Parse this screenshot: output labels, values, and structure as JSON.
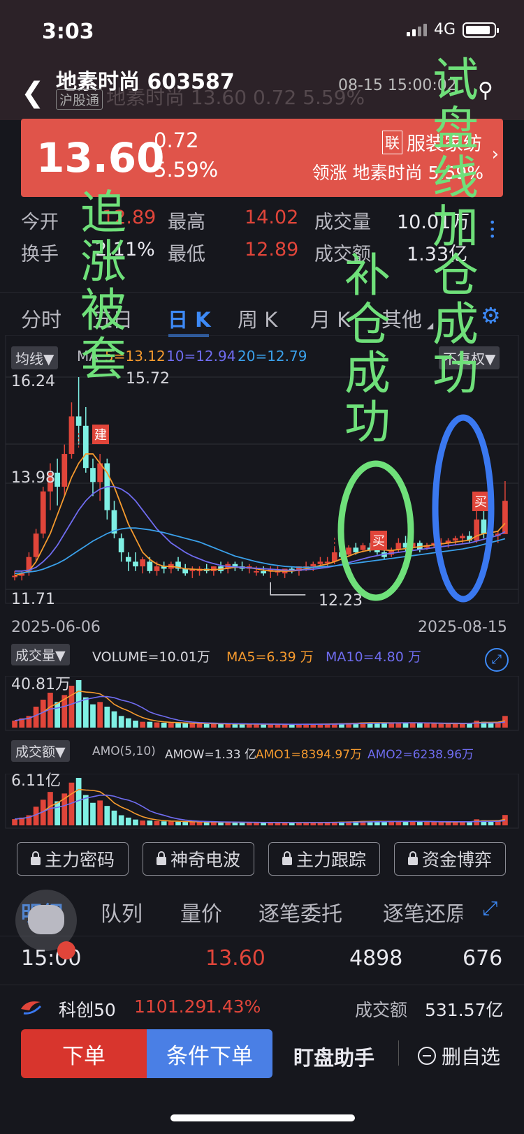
{
  "status": {
    "time": "3:03",
    "network": "4G"
  },
  "header": {
    "title": "地素时尚 603587",
    "badge": "沪股通",
    "ghost": "地素时尚  13.60  0.72  5.59%",
    "datetime": "08-15 15:00:02"
  },
  "price": {
    "last": "13.60",
    "change": "0.72",
    "pct": "5.59%",
    "sector_badge": "联",
    "sector": "服装家纺",
    "lead": "领涨 地素时尚 5.59%"
  },
  "stats": {
    "open_label": "今开",
    "open": "12.89",
    "high_label": "最高",
    "high": "14.02",
    "vol_label": "成交量",
    "vol": "10.01万",
    "turnover_label": "换手",
    "turnover": "2.11%",
    "low_label": "最低",
    "low": "12.89",
    "amt_label": "成交额",
    "amt": "1.33亿"
  },
  "tabs": [
    {
      "label": "分时"
    },
    {
      "label": "五日"
    },
    {
      "label": "日 K"
    },
    {
      "label": "周 K"
    },
    {
      "label": "月 K"
    },
    {
      "label": "其他"
    }
  ],
  "kchart": {
    "ma_pill": "均线▼",
    "ma_title": "MA",
    "ma5": "5=13.12",
    "ma10": "10=12.94",
    "ma20": "20=12.79",
    "adjust_pill": "不复权▼",
    "y_top": "16.24",
    "y_mid": "13.98",
    "y_bot": "11.71",
    "max_label": "15.72",
    "min_label": "12.23",
    "date_start": "2025-06-06",
    "date_end": "2025-08-15",
    "mark_build": "建",
    "mark_buy1": "买",
    "mark_buy2": "买"
  },
  "volume": {
    "pill": "成交量▼",
    "main": "VOLUME=10.01万",
    "ma5": "MA5=6.39 万",
    "ma10": "MA10=4.80 万",
    "max": "40.81万"
  },
  "amount": {
    "pill": "成交额▼",
    "params": "AMO(5,10)",
    "amow": "AMOW=1.33 亿",
    "amo1": "AMO1=8394.97万",
    "amo2": "AMO2=6238.96万",
    "max": "6.11亿"
  },
  "tool_buttons": [
    "主力密码",
    "神奇电波",
    "主力跟踪",
    "资金博弈"
  ],
  "detail_tabs": [
    "明细",
    "队列",
    "量价",
    "逐笔委托",
    "逐笔还原"
  ],
  "tick": {
    "time": "15:00",
    "price": "13.60",
    "volume": "4898",
    "count": "676"
  },
  "index_bar": {
    "name": "科创50",
    "value": "1101.29",
    "pct": "1.43%",
    "amt_label": "成交额",
    "amt": "531.57亿"
  },
  "actions": {
    "order": "下单",
    "conditional": "条件下单",
    "assistant": "盯盘助手",
    "remove_fav": "删自选"
  },
  "annotations": {
    "left": "追涨被套",
    "middle": "补仓成功",
    "right": "试盘线加仓成功"
  },
  "colors": {
    "up": "#e0453a",
    "down": "#7ff0e4",
    "ma5": "#f59a2e",
    "ma10": "#6f6cf0",
    "ma20": "#3aa0ea",
    "accent": "#3d8af7",
    "anno_green": "#6fe07a",
    "circle_green": "#6fe07a",
    "circle_blue": "#3a78f0"
  },
  "chart_data": [
    {
      "type": "candlestick",
      "title": "日K",
      "x_start": "2025-06-06",
      "x_end": "2025-08-15",
      "ylim": [
        11.71,
        16.24
      ],
      "candles": [
        [
          12.0,
          12.1,
          11.9,
          12.0
        ],
        [
          12.0,
          12.1,
          11.9,
          12.05
        ],
        [
          12.1,
          12.5,
          12.0,
          12.4
        ],
        [
          12.4,
          13.0,
          12.3,
          12.9
        ],
        [
          12.9,
          13.9,
          12.8,
          13.8
        ],
        [
          13.8,
          14.4,
          13.4,
          14.2
        ],
        [
          14.2,
          14.5,
          13.5,
          13.9
        ],
        [
          13.9,
          14.8,
          13.7,
          14.6
        ],
        [
          14.6,
          15.7,
          14.5,
          15.4
        ],
        [
          15.4,
          16.24,
          14.8,
          15.2
        ],
        [
          15.2,
          15.6,
          14.2,
          14.3
        ],
        [
          14.3,
          14.5,
          13.7,
          14.0
        ],
        [
          14.0,
          14.6,
          13.6,
          14.4
        ],
        [
          14.4,
          14.5,
          13.2,
          13.4
        ],
        [
          13.4,
          13.6,
          12.8,
          12.9
        ],
        [
          12.8,
          12.9,
          12.3,
          12.5
        ],
        [
          12.4,
          12.5,
          12.1,
          12.3
        ],
        [
          12.3,
          12.5,
          12.1,
          12.2
        ],
        [
          12.2,
          12.4,
          12.05,
          12.35
        ],
        [
          12.3,
          12.4,
          12.05,
          12.1
        ],
        [
          12.1,
          12.3,
          12.0,
          12.2
        ],
        [
          12.2,
          12.3,
          12.05,
          12.15
        ],
        [
          12.15,
          12.3,
          12.05,
          12.25
        ],
        [
          12.3,
          12.4,
          12.1,
          12.15
        ],
        [
          12.15,
          12.25,
          12.0,
          12.05
        ],
        [
          12.1,
          12.2,
          11.95,
          12.15
        ],
        [
          12.1,
          12.2,
          12.0,
          12.15
        ],
        [
          12.15,
          12.25,
          12.05,
          12.1
        ],
        [
          12.1,
          12.2,
          12.0,
          12.2
        ],
        [
          12.2,
          12.3,
          12.05,
          12.1
        ],
        [
          12.15,
          12.3,
          12.05,
          12.25
        ],
        [
          12.25,
          12.3,
          12.1,
          12.2
        ],
        [
          12.2,
          12.3,
          12.1,
          12.15
        ],
        [
          12.15,
          12.25,
          12.05,
          12.2
        ],
        [
          12.1,
          12.2,
          12.0,
          12.1
        ],
        [
          12.1,
          12.2,
          12.0,
          12.05
        ],
        [
          12.1,
          12.2,
          11.95,
          12.15
        ],
        [
          12.1,
          12.2,
          12.0,
          12.1
        ],
        [
          12.05,
          12.15,
          11.95,
          12.15
        ],
        [
          12.15,
          12.2,
          12.05,
          12.1
        ],
        [
          12.1,
          12.2,
          12.0,
          12.2
        ],
        [
          12.2,
          12.3,
          12.1,
          12.2
        ],
        [
          12.2,
          12.3,
          12.1,
          12.25
        ],
        [
          12.25,
          12.4,
          12.2,
          12.3
        ],
        [
          12.3,
          12.4,
          12.2,
          12.3
        ],
        [
          12.3,
          12.6,
          12.25,
          12.5
        ],
        [
          12.5,
          12.6,
          12.35,
          12.4
        ],
        [
          12.45,
          12.65,
          12.4,
          12.6
        ],
        [
          12.6,
          12.7,
          12.45,
          12.5
        ],
        [
          12.55,
          12.7,
          12.5,
          12.65
        ],
        [
          12.6,
          12.7,
          12.5,
          12.55
        ],
        [
          12.55,
          12.7,
          12.45,
          12.5
        ],
        [
          12.5,
          12.6,
          12.35,
          12.4
        ],
        [
          12.45,
          12.6,
          12.4,
          12.55
        ],
        [
          12.55,
          12.8,
          12.5,
          12.7
        ],
        [
          12.7,
          12.85,
          12.5,
          12.6
        ],
        [
          12.6,
          12.75,
          12.55,
          12.7
        ],
        [
          12.7,
          12.75,
          12.5,
          12.55
        ],
        [
          12.6,
          12.7,
          12.55,
          12.65
        ],
        [
          12.65,
          12.7,
          12.6,
          12.7
        ],
        [
          12.7,
          12.8,
          12.6,
          12.7
        ],
        [
          12.7,
          12.8,
          12.6,
          12.75
        ],
        [
          12.75,
          12.85,
          12.65,
          12.8
        ],
        [
          12.8,
          12.9,
          12.7,
          12.85
        ],
        [
          12.85,
          12.95,
          12.7,
          12.75
        ],
        [
          12.75,
          13.4,
          12.7,
          13.2
        ],
        [
          13.2,
          13.5,
          12.8,
          12.9
        ],
        [
          12.9,
          13.0,
          12.75,
          12.85
        ],
        [
          12.85,
          12.95,
          12.7,
          12.9
        ],
        [
          12.89,
          14.02,
          12.89,
          13.6
        ]
      ],
      "ma5": [
        12.0,
        12.05,
        12.1,
        12.3,
        12.6,
        12.9,
        13.3,
        13.7,
        14.1,
        14.4,
        14.6,
        14.6,
        14.4,
        14.2,
        13.9,
        13.5,
        13.1,
        12.8,
        12.5,
        12.35,
        12.25,
        12.2,
        12.2,
        12.18,
        12.15,
        12.14,
        12.13,
        12.13,
        12.13,
        12.14,
        12.16,
        12.18,
        12.18,
        12.17,
        12.15,
        12.12,
        12.1,
        12.1,
        12.1,
        12.1,
        12.12,
        12.15,
        12.18,
        12.22,
        12.25,
        12.3,
        12.36,
        12.42,
        12.48,
        12.52,
        12.55,
        12.56,
        12.55,
        12.54,
        12.56,
        12.58,
        12.6,
        12.62,
        12.64,
        12.66,
        12.68,
        12.7,
        12.72,
        12.74,
        12.76,
        12.85,
        12.9,
        12.92,
        12.95,
        13.12
      ],
      "ma10": [
        12.1,
        12.1,
        12.12,
        12.18,
        12.3,
        12.45,
        12.65,
        12.9,
        13.15,
        13.4,
        13.6,
        13.75,
        13.85,
        13.9,
        13.9,
        13.85,
        13.75,
        13.6,
        13.4,
        13.2,
        13.0,
        12.85,
        12.7,
        12.6,
        12.5,
        12.42,
        12.36,
        12.3,
        12.26,
        12.22,
        12.2,
        12.19,
        12.18,
        12.17,
        12.16,
        12.15,
        12.14,
        12.13,
        12.12,
        12.12,
        12.12,
        12.13,
        12.14,
        12.16,
        12.18,
        12.21,
        12.24,
        12.28,
        12.32,
        12.36,
        12.4,
        12.43,
        12.46,
        12.48,
        12.5,
        12.52,
        12.54,
        12.56,
        12.58,
        12.6,
        12.62,
        12.64,
        12.66,
        12.68,
        12.7,
        12.74,
        12.78,
        12.82,
        12.86,
        12.94
      ],
      "ma20": [
        12.05,
        12.06,
        12.08,
        12.1,
        12.14,
        12.2,
        12.26,
        12.34,
        12.44,
        12.54,
        12.64,
        12.74,
        12.82,
        12.9,
        12.96,
        13.0,
        13.02,
        13.02,
        13.0,
        12.98,
        12.95,
        12.92,
        12.88,
        12.84,
        12.8,
        12.76,
        12.72,
        12.66,
        12.6,
        12.54,
        12.48,
        12.42,
        12.38,
        12.34,
        12.3,
        12.27,
        12.24,
        12.22,
        12.2,
        12.19,
        12.18,
        12.18,
        12.18,
        12.19,
        12.2,
        12.21,
        12.23,
        12.25,
        12.27,
        12.29,
        12.31,
        12.33,
        12.35,
        12.37,
        12.39,
        12.41,
        12.43,
        12.45,
        12.47,
        12.49,
        12.51,
        12.53,
        12.55,
        12.57,
        12.6,
        12.63,
        12.67,
        12.71,
        12.75,
        12.79
      ]
    },
    {
      "type": "bar",
      "title": "成交量",
      "ylim": [
        0,
        40.81
      ],
      "values": [
        6,
        8,
        10,
        18,
        24,
        30,
        22,
        28,
        36,
        40.81,
        26,
        20,
        22,
        18,
        14,
        10,
        8,
        6,
        5,
        5,
        4.5,
        4.2,
        4,
        3.8,
        3.6,
        3.5,
        3.4,
        3.3,
        3.2,
        3.2,
        3.1,
        3,
        3,
        3,
        2.9,
        2.9,
        2.8,
        2.8,
        2.8,
        2.8,
        2.9,
        3,
        3,
        3.1,
        3.2,
        3.5,
        3.8,
        4,
        4.2,
        4.5,
        4.2,
        4,
        3.8,
        4,
        4.4,
        4.2,
        4,
        3.8,
        3.6,
        3.4,
        3.2,
        3.4,
        3.6,
        3.8,
        4,
        6,
        5,
        4,
        4.5,
        10.01
      ]
    },
    {
      "type": "bar",
      "title": "成交额",
      "ylim": [
        0,
        6.11
      ],
      "values": [
        0.8,
        1.0,
        1.3,
        2.4,
        3.3,
        4.3,
        3.1,
        4.1,
        5.5,
        6.11,
        3.9,
        2.9,
        3.2,
        2.5,
        1.9,
        1.3,
        1.0,
        0.75,
        0.62,
        0.62,
        0.55,
        0.52,
        0.49,
        0.47,
        0.44,
        0.43,
        0.42,
        0.4,
        0.39,
        0.39,
        0.38,
        0.37,
        0.37,
        0.37,
        0.36,
        0.36,
        0.35,
        0.35,
        0.35,
        0.35,
        0.36,
        0.37,
        0.37,
        0.38,
        0.39,
        0.43,
        0.47,
        0.5,
        0.52,
        0.56,
        0.52,
        0.5,
        0.47,
        0.5,
        0.55,
        0.53,
        0.5,
        0.47,
        0.45,
        0.43,
        0.4,
        0.43,
        0.45,
        0.48,
        0.51,
        0.78,
        0.65,
        0.52,
        0.58,
        1.33
      ]
    }
  ]
}
